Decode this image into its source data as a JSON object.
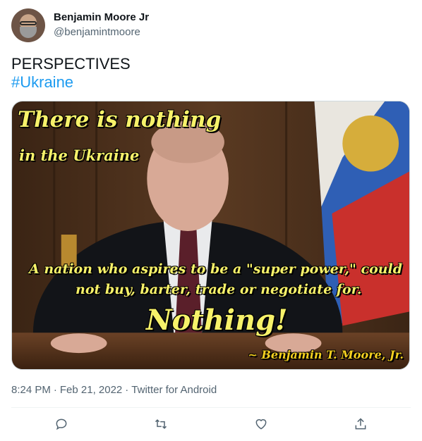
{
  "author": {
    "name": "Benjamin Moore Jr",
    "handle": "@benjamintmoore"
  },
  "tweet": {
    "text": "PERSPECTIVES",
    "hashtag": "#Ukraine"
  },
  "image_text": {
    "line1": "There is nothing",
    "line2": "in the Ukraine",
    "line3": "A nation who aspires to be a \"super power,\" could",
    "line4": "not buy, barter, trade or negotiate for.",
    "line5": "Nothing!",
    "signature": "~ Benjamin T. Moore, Jr."
  },
  "meta": {
    "time": "8:24 PM",
    "separator": "·",
    "date": "Feb 21, 2022",
    "source": "Twitter for Android"
  },
  "actions": {
    "reply_icon": "reply-icon",
    "retweet_icon": "retweet-icon",
    "like_icon": "heart-icon",
    "share_icon": "share-icon"
  },
  "colors": {
    "link": "#1d9bf0",
    "secondary_text": "#536471",
    "overlay_text": "#f7f26a"
  }
}
